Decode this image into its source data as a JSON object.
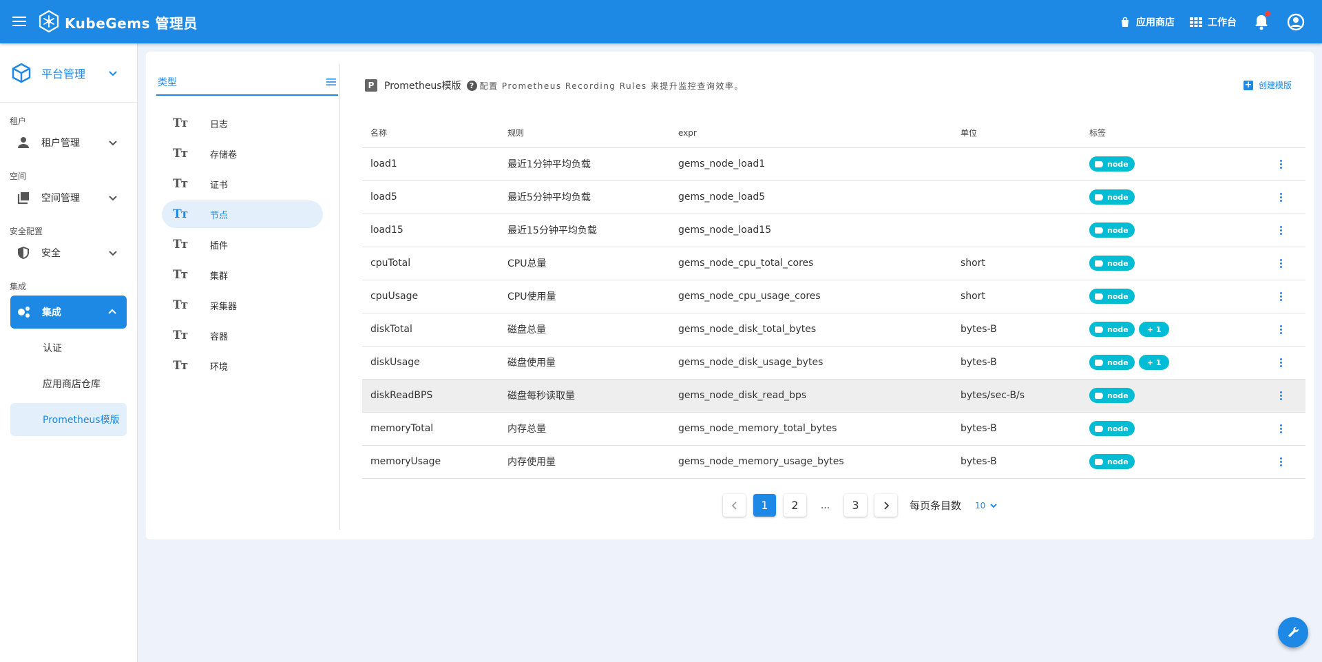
{
  "header": {
    "brand": "KubeGems 管理员",
    "app_store": "应用商店",
    "workbench": "工作台"
  },
  "sidebar": {
    "platform": "平台管理",
    "groups": [
      {
        "title": "租户",
        "item": "租户管理"
      },
      {
        "title": "空间",
        "item": "空间管理"
      },
      {
        "title": "安全配置",
        "item": "安全"
      },
      {
        "title": "集成",
        "item": "集成"
      }
    ],
    "sub_items": [
      "认证",
      "应用商店仓库",
      "Prometheus模版"
    ]
  },
  "types": {
    "header": "类型",
    "items": [
      "日志",
      "存储卷",
      "证书",
      "节点",
      "插件",
      "集群",
      "采集器",
      "容器",
      "环境"
    ],
    "active_index": 3,
    "glyph": "Tт"
  },
  "content": {
    "badge": "P",
    "title": "Prometheus模版",
    "description": "配置 Prometheus Recording Rules 来提升监控查询效率。",
    "create_button": "创建模版"
  },
  "table": {
    "columns": [
      "名称",
      "规则",
      "expr",
      "单位",
      "标签"
    ],
    "rows": [
      {
        "name": "load1",
        "rule": "最近1分钟平均负载",
        "expr": "gems_node_load1",
        "unit": "",
        "tag": "node",
        "extra": ""
      },
      {
        "name": "load5",
        "rule": "最近5分钟平均负载",
        "expr": "gems_node_load5",
        "unit": "",
        "tag": "node",
        "extra": ""
      },
      {
        "name": "load15",
        "rule": "最近15分钟平均负载",
        "expr": "gems_node_load15",
        "unit": "",
        "tag": "node",
        "extra": ""
      },
      {
        "name": "cpuTotal",
        "rule": "CPU总量",
        "expr": "gems_node_cpu_total_cores",
        "unit": "short",
        "tag": "node",
        "extra": ""
      },
      {
        "name": "cpuUsage",
        "rule": "CPU使用量",
        "expr": "gems_node_cpu_usage_cores",
        "unit": "short",
        "tag": "node",
        "extra": ""
      },
      {
        "name": "diskTotal",
        "rule": "磁盘总量",
        "expr": "gems_node_disk_total_bytes",
        "unit": "bytes-B",
        "tag": "node",
        "extra": "+ 1"
      },
      {
        "name": "diskUsage",
        "rule": "磁盘使用量",
        "expr": "gems_node_disk_usage_bytes",
        "unit": "bytes-B",
        "tag": "node",
        "extra": "+ 1"
      },
      {
        "name": "diskReadBPS",
        "rule": "磁盘每秒读取量",
        "expr": "gems_node_disk_read_bps",
        "unit": "bytes/sec-B/s",
        "tag": "node",
        "extra": ""
      },
      {
        "name": "memoryTotal",
        "rule": "内存总量",
        "expr": "gems_node_memory_total_bytes",
        "unit": "bytes-B",
        "tag": "node",
        "extra": ""
      },
      {
        "name": "memoryUsage",
        "rule": "内存使用量",
        "expr": "gems_node_memory_usage_bytes",
        "unit": "bytes-B",
        "tag": "node",
        "extra": ""
      }
    ],
    "highlight_index": 7
  },
  "pagination": {
    "pages": [
      "1",
      "2",
      "...",
      "3"
    ],
    "current": "1",
    "per_page_label": "每页条目数",
    "per_page_value": "10"
  },
  "colors": {
    "primary": "#1e88e5",
    "chip": "#00bcd4",
    "badge": "#f44336"
  }
}
